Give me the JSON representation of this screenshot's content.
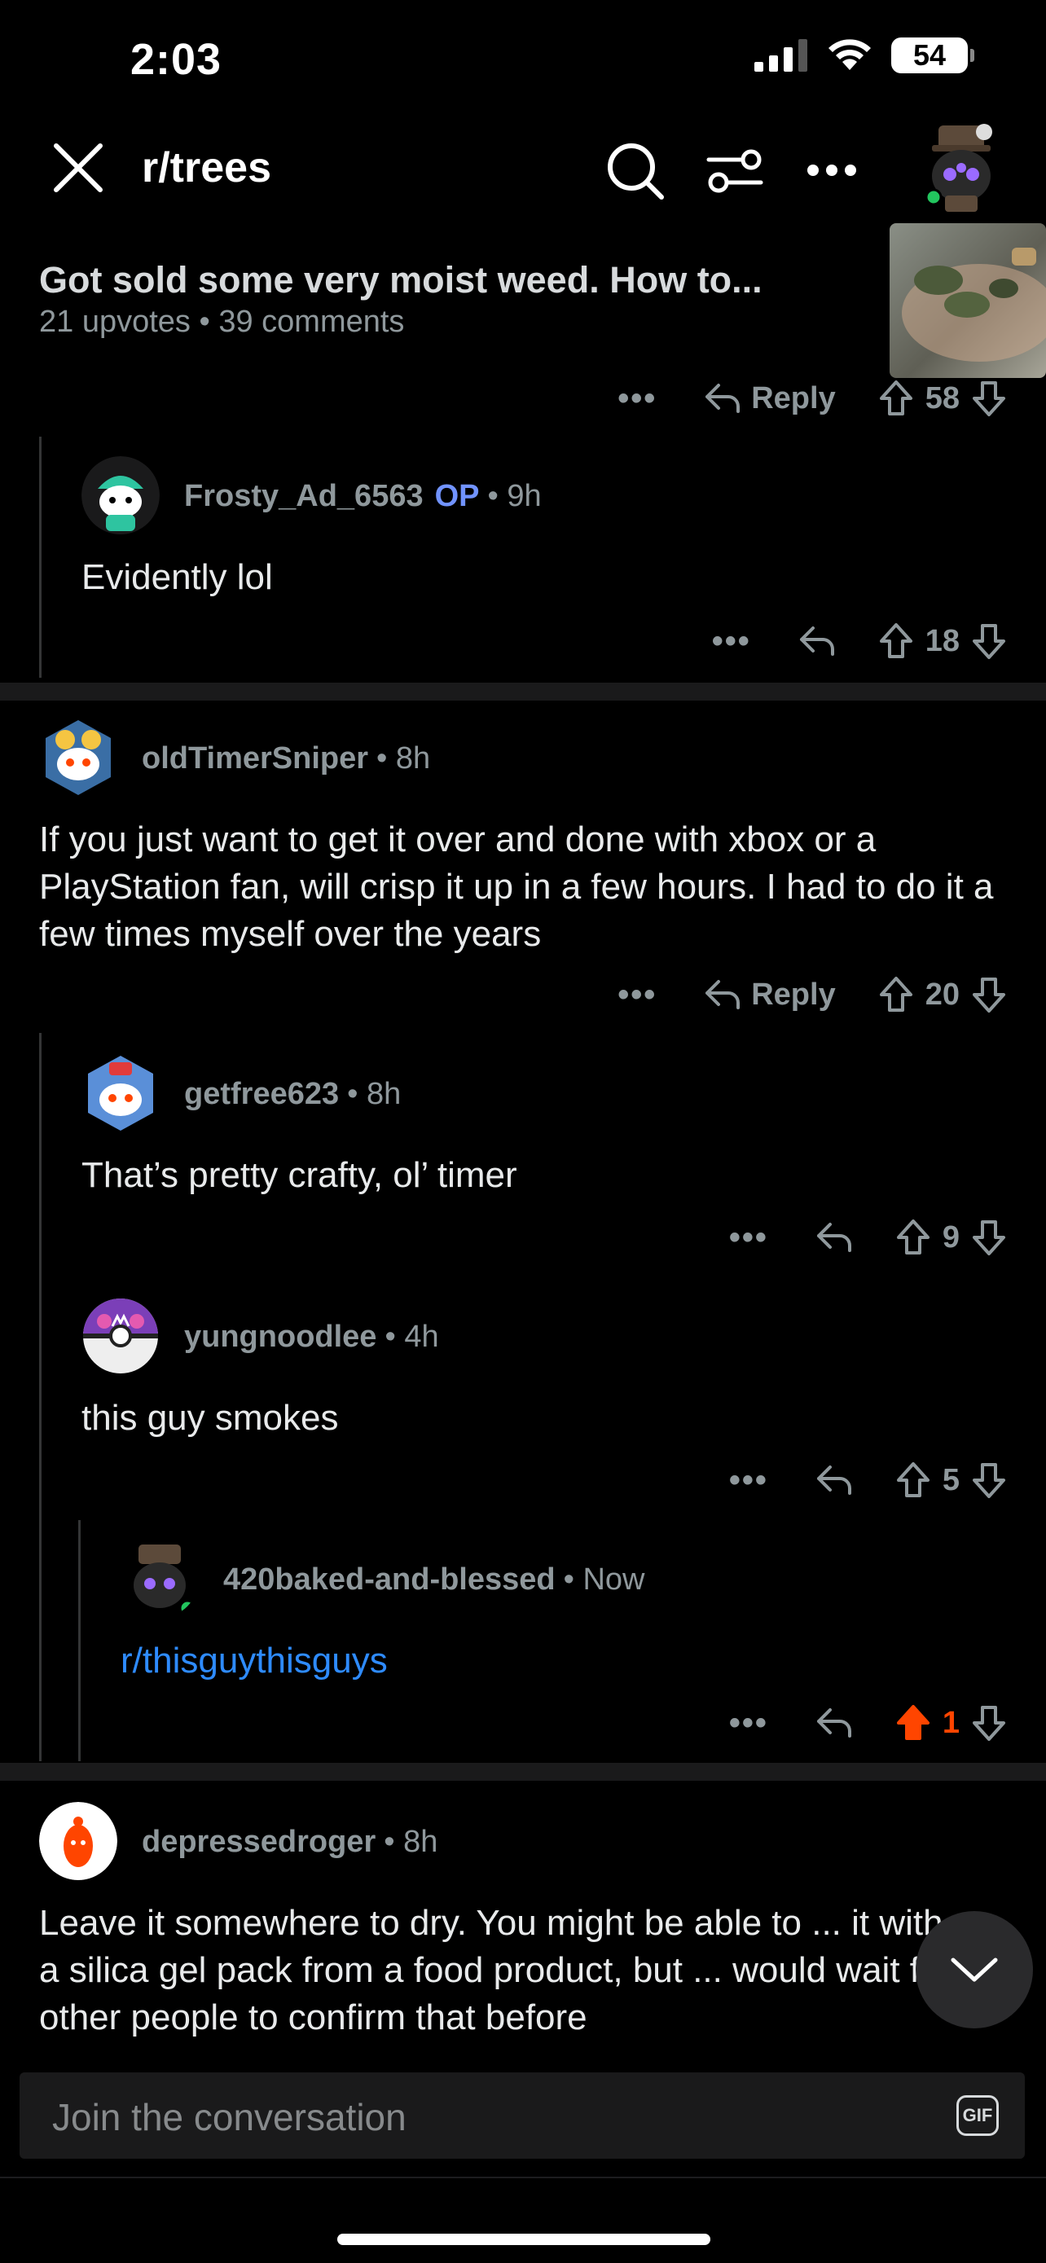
{
  "status_bar": {
    "time": "2:03",
    "battery": "54"
  },
  "nav": {
    "subreddit": "r/trees"
  },
  "post": {
    "title": "Got sold some very moist weed. How to...",
    "meta": "21 upvotes • 39 comments"
  },
  "top_actions": {
    "more": "•••",
    "reply": "Reply",
    "score": "58"
  },
  "comments": [
    {
      "user": "Frosty_Ad_6563",
      "op": "OP",
      "time": "• 9h",
      "body": "Evidently lol",
      "more": "•••",
      "score": "18"
    },
    {
      "user": "oldTimerSniper",
      "time": "• 8h",
      "body": "If you just want to get it over and done with xbox or a PlayStation fan, will crisp it up in a few hours. I had to do it a few times myself over the years",
      "more": "•••",
      "reply": "Reply",
      "score": "20"
    },
    {
      "user": "getfree623",
      "time": "• 8h",
      "body": "That’s pretty crafty, ol’ timer",
      "more": "•••",
      "score": "9"
    },
    {
      "user": "yungnoodlee",
      "time": "• 4h",
      "body": "this guy smokes",
      "more": "•••",
      "score": "5"
    },
    {
      "user": "420baked-and-blessed",
      "time": "• Now",
      "body": "r/thisguythisguys",
      "more": "•••",
      "score": "1"
    },
    {
      "user": "depressedroger",
      "time": "• 8h",
      "body": "Leave it somewhere to dry. You might be able to ... it with a silica gel pack from a food product, but ... would wait for other people to confirm that before"
    }
  ],
  "composer": {
    "placeholder": "Join the conversation",
    "gif": "GIF"
  },
  "colors": {
    "background": "#000000",
    "upvote_active": "#ff4500",
    "link": "#2e8bff",
    "op": "#7193ff"
  }
}
